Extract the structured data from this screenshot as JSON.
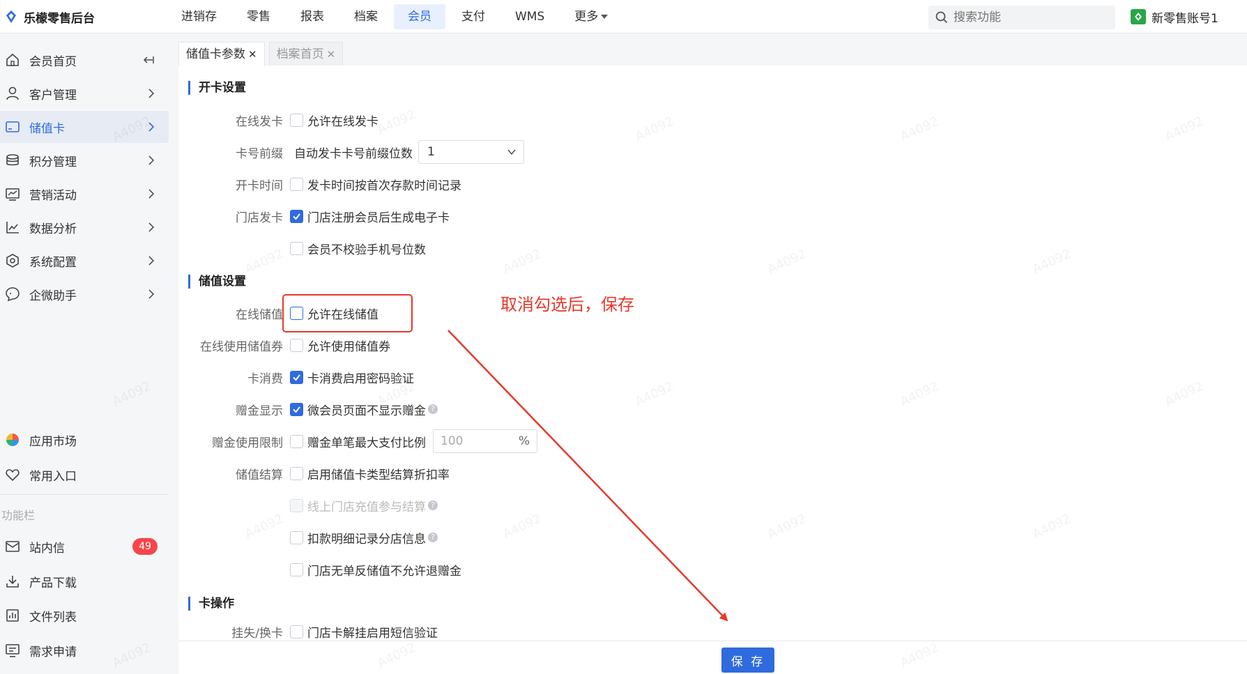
{
  "brand": {
    "title": "乐檬零售后台"
  },
  "topnav": [
    {
      "label": "进销存"
    },
    {
      "label": "零售"
    },
    {
      "label": "报表"
    },
    {
      "label": "档案"
    },
    {
      "label": "会员",
      "active": true
    },
    {
      "label": "支付"
    },
    {
      "label": "WMS"
    },
    {
      "label": "更多"
    }
  ],
  "search": {
    "placeholder": "搜索功能"
  },
  "account": {
    "name": "新零售账号1"
  },
  "sidebar": {
    "items": [
      {
        "label": "会员首页",
        "icon": "home-icon"
      },
      {
        "label": "客户管理",
        "icon": "user-icon"
      },
      {
        "label": "储值卡",
        "icon": "card-icon",
        "active": true
      },
      {
        "label": "积分管理",
        "icon": "coins-icon"
      },
      {
        "label": "营销活动",
        "icon": "marketing-icon"
      },
      {
        "label": "数据分析",
        "icon": "chart-icon"
      },
      {
        "label": "系统配置",
        "icon": "settings-icon"
      },
      {
        "label": "企微助手",
        "icon": "chat-icon"
      }
    ],
    "bottom": [
      {
        "label": "应用市场",
        "icon": "app-market-icon"
      },
      {
        "label": "常用入口",
        "icon": "heart-icon"
      }
    ],
    "section_label": "功能栏",
    "tools": [
      {
        "label": "站内信",
        "icon": "mail-icon",
        "badge": "49"
      },
      {
        "label": "产品下载",
        "icon": "download-icon"
      },
      {
        "label": "文件列表",
        "icon": "file-list-icon"
      },
      {
        "label": "需求申请",
        "icon": "request-icon"
      }
    ]
  },
  "tabs": [
    {
      "label": "储值卡参数",
      "close": "✕",
      "active": true
    },
    {
      "label": "档案首页",
      "close": "✕",
      "active": false
    }
  ],
  "sections": {
    "open_card": "开卡设置",
    "stored_value": "储值设置",
    "card_ops": "卡操作"
  },
  "form": {
    "online_issue": {
      "label": "在线发卡",
      "option": "允许在线发卡",
      "checked": false
    },
    "card_prefix": {
      "label": "卡号前缀",
      "option": "自动发卡卡号前缀位数",
      "select_value": "1"
    },
    "issue_time": {
      "label": "开卡时间",
      "option": "发卡时间按首次存款时间记录",
      "checked": false
    },
    "store_issue": {
      "label": "门店发卡",
      "option": "门店注册会员后生成电子卡",
      "checked": true
    },
    "no_phone_check": {
      "option": "会员不校验手机号位数",
      "checked": false
    },
    "online_recharge": {
      "label": "在线储值",
      "option": "允许在线储值",
      "checked": false
    },
    "online_coupon": {
      "label": "在线使用储值券",
      "option": "允许使用储值券",
      "checked": false
    },
    "card_consume": {
      "label": "卡消费",
      "option": "卡消费启用密码验证",
      "checked": true
    },
    "gift_display": {
      "label": "赠金显示",
      "option": "微会员页面不显示赠金",
      "checked": true
    },
    "gift_limit": {
      "label": "赠金使用限制",
      "option": "赠金单笔最大支付比例",
      "checked": false,
      "placeholder": "100",
      "unit": "%"
    },
    "settlement": {
      "label": "储值结算",
      "option": "启用储值卡类型结算折扣率",
      "checked": false
    },
    "online_store_recharge": {
      "option": "线上门店充值参与结算",
      "checked": false,
      "disabled": true
    },
    "deduct_detail": {
      "option": "扣款明细记录分店信息",
      "checked": false
    },
    "no_refund": {
      "option": "门店无单反储值不允许退赠金",
      "checked": false
    },
    "lost_replace": {
      "label": "挂失/换卡",
      "option": "门店卡解挂启用短信验证",
      "checked": false
    }
  },
  "save_button": "保 存",
  "annotation": {
    "text": "取消勾选后，保存"
  },
  "watermark": "A4092"
}
